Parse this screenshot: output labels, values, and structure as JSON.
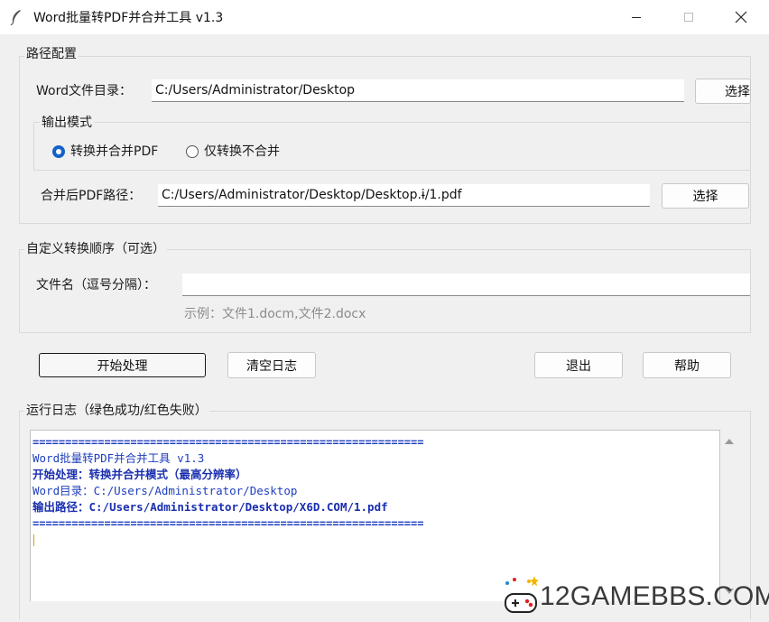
{
  "window": {
    "title": "Word批量转PDF并合并工具 v1.3"
  },
  "path_config": {
    "group_title": "路径配置",
    "word_dir_label": "Word文件目录：",
    "word_dir_value": "C:/Users/Administrator/Desktop",
    "word_dir_button": "选择",
    "output_mode": {
      "group_title": "输出模式",
      "options": [
        {
          "label": "转换并合并PDF",
          "selected": true
        },
        {
          "label": "仅转换不合并",
          "selected": false
        }
      ]
    },
    "merged_path_label": "合并后PDF路径：",
    "merged_path_value": "C:/Users/Administrator/Desktop/Desktop.ɨ/1.pdf",
    "merged_path_button": "选择"
  },
  "custom_order": {
    "group_title": "自定义转换顺序（可选）",
    "filename_label": "文件名（逗号分隔）：",
    "filename_value": "",
    "example": "示例：文件1.docm,文件2.docx"
  },
  "actions": {
    "start": "开始处理",
    "clear_log": "清空日志",
    "exit": "退出",
    "help": "帮助"
  },
  "log": {
    "group_title": "运行日志（绿色成功/红色失败）",
    "separator": "============================================================",
    "lines": [
      {
        "text": "Word批量转PDF并合并工具 v1.3",
        "style": "normal"
      },
      {
        "text": "开始处理：转换并合并模式（最高分辨率）",
        "style": "bold"
      },
      {
        "text": "Word目录：C:/Users/Administrator/Desktop",
        "style": "normal"
      },
      {
        "text": "输出路径：C:/Users/Administrator/Desktop/X6D.COM/1.pdf",
        "style": "bold"
      }
    ]
  },
  "watermark": {
    "text": "12GAMEBBS.COM"
  },
  "colors": {
    "accent": "#1461c8",
    "log_text": "#1f3fbf"
  }
}
